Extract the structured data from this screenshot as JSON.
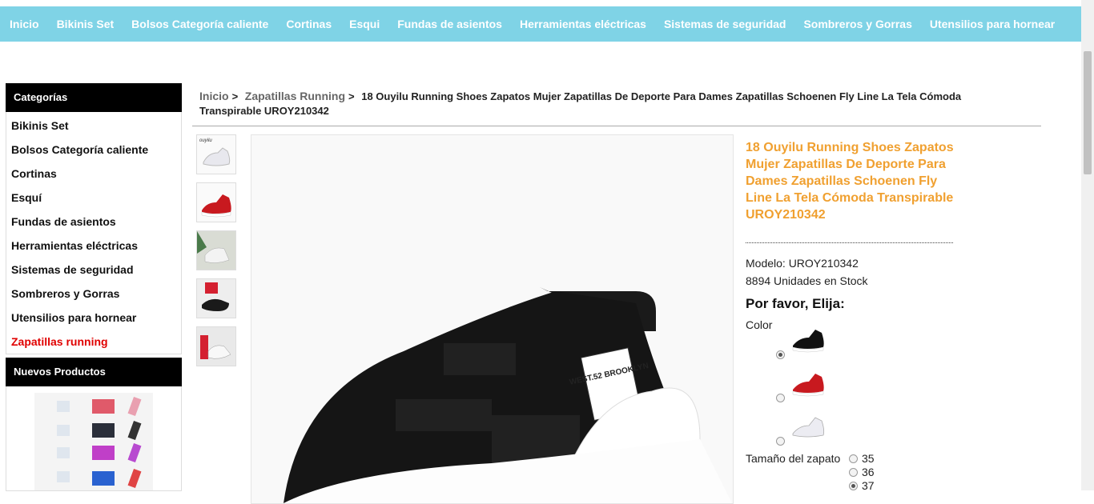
{
  "top_nav": [
    "Inicio",
    "Bikinis Set",
    "Bolsos Categoría caliente",
    "Cortinas",
    "Esqui",
    "Fundas de asientos",
    "Herramientas eléctricas",
    "Sistemas de seguridad",
    "Sombreros y Gorras",
    "Utensilios para hornear"
  ],
  "sidebar": {
    "categories_title": "Categorías",
    "items": [
      "Bikinis Set",
      "Bolsos Categoría caliente",
      "Cortinas",
      "Esquí",
      "Fundas de asientos",
      "Herramientas eléctricas",
      "Sistemas de seguridad",
      "Sombreros y Gorras",
      "Utensilios para hornear",
      "Zapatillas running"
    ],
    "active_item": "Zapatillas running",
    "new_products_title": "Nuevos Productos"
  },
  "breadcrumb": {
    "home": "Inicio",
    "category": "Zapatillas Running",
    "separator": ">",
    "current": "18 Ouyilu Running Shoes Zapatos Mujer Zapatillas De Deporte Para Dames Zapatillas Schoenen Fly Line La Tela Cómoda Transpirable UROY210342"
  },
  "product": {
    "title": "18 Ouyilu Running Shoes Zapatos Mujer Zapatillas De Deporte Para Dames Zapatillas Schoenen Fly Line La Tela Cómoda Transpirable UROY210342",
    "model": "Modelo: UROY210342",
    "stock": "8894 Unidades en Stock",
    "choose_label": "Por favor, Elija:",
    "color_label": "Color",
    "colors": [
      "black",
      "red",
      "white"
    ],
    "selected_color": "black",
    "size_label": "Tamaño del zapato",
    "sizes": [
      "35",
      "36",
      "37"
    ],
    "selected_size": "37",
    "thumbnail_watermark": "ouyilu",
    "shoe_tag_text": "WEST.52 BROOKLYN"
  },
  "colors": {
    "nav_bg": "#7fd3e6",
    "title": "#f0a030",
    "active_category": "#e00000",
    "sidebar_header_bg": "#000000"
  }
}
